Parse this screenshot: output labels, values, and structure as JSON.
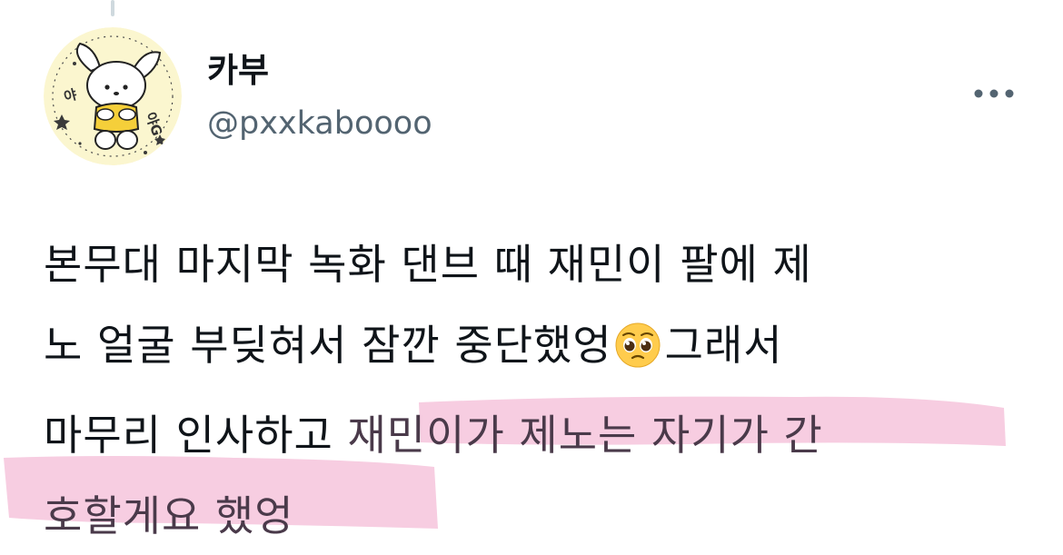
{
  "tweet": {
    "display_name": "카부",
    "handle": "@pxxkaboooo",
    "avatar_icon": "pochacco-avatar-icon",
    "more_icon": "more-options-icon",
    "text": {
      "line1": "본무대 마지막 녹화 댄브 때 재민이 팔에 제",
      "line2_before_emoji": "노 얼굴 부딪혀서 잠깐 중단했엉",
      "line2_after_emoji": "그래서",
      "line3_plain": "마무리 인사하고 ",
      "line3_highlighted": "재민이가 제노는 자기가 간",
      "line4_highlighted": "호할게요 했엉",
      "emoji": "pleading-face-emoji"
    },
    "avatar_text_left": "야",
    "avatar_text_right": "야G",
    "highlight_color": "#f2b8d4"
  }
}
